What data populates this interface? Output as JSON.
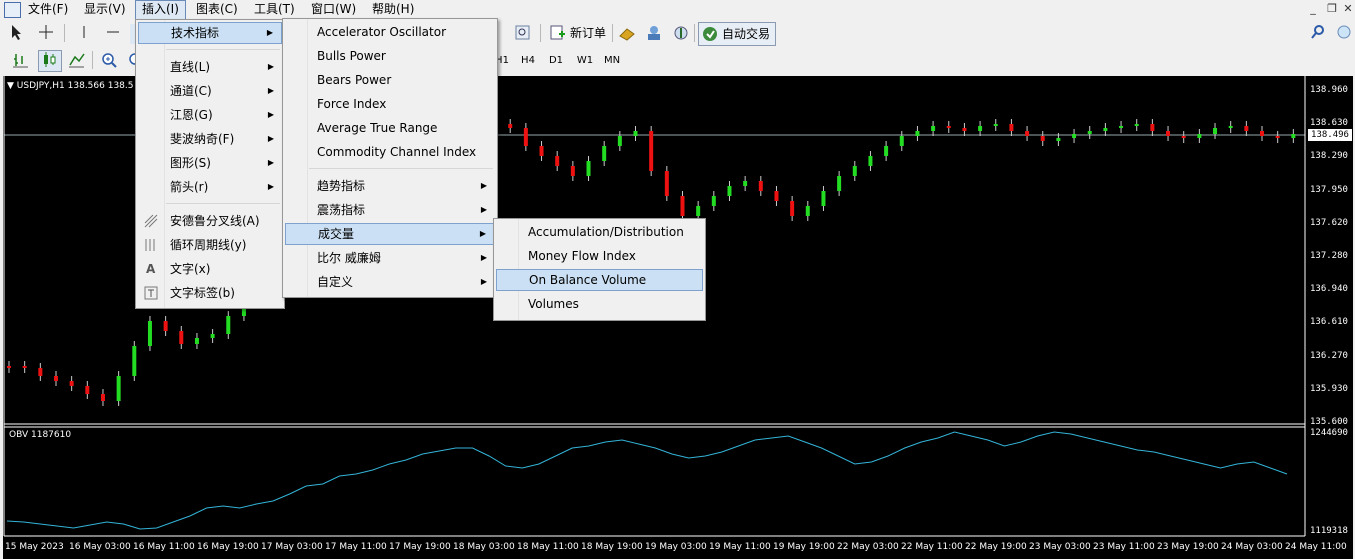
{
  "menubar": {
    "items": [
      "文件(F)",
      "显示(V)",
      "插入(I)",
      "图表(C)",
      "工具(T)",
      "窗口(W)",
      "帮助(H)"
    ]
  },
  "toolbar": {
    "new_order": "新订单",
    "auto_trading": "自动交易",
    "timeframes": [
      "H1",
      "H4",
      "D1",
      "W1",
      "MN"
    ]
  },
  "insert_menu": {
    "items": [
      "技术指标",
      "直线(L)",
      "通道(C)",
      "江恩(G)",
      "斐波纳奇(F)",
      "图形(S)",
      "箭头(r)",
      "安德鲁分叉线(A)",
      "循环周期线(y)",
      "文字(x)",
      "文字标签(b)"
    ]
  },
  "indicators_menu": {
    "items": [
      "Accelerator Oscillator",
      "Bulls Power",
      "Bears Power",
      "Force Index",
      "Average True Range",
      "Commodity Channel Index",
      "趋势指标",
      "震荡指标",
      "成交量",
      "比尔 威廉姆",
      "自定义"
    ]
  },
  "volumes_menu": {
    "items": [
      "Accumulation/Distribution",
      "Money Flow Index",
      "On Balance Volume",
      "Volumes"
    ]
  },
  "chart": {
    "symbol_label": "USDJPY,H1",
    "ohlc_partial": "138.566 138.5",
    "obv_label": "OBV 1187610",
    "current_price": "138.496",
    "price_axis": [
      "138.960",
      "138.630",
      "138.290",
      "137.950",
      "137.620",
      "137.280",
      "136.940",
      "136.610",
      "136.270",
      "135.930",
      "135.600"
    ],
    "obv_axis": [
      "1244690",
      "1119318"
    ],
    "time_axis": [
      "15 May 2023",
      "16 May 03:00",
      "16 May 11:00",
      "16 May 19:00",
      "17 May 03:00",
      "17 May 11:00",
      "17 May 19:00",
      "18 May 03:00",
      "18 May 11:00",
      "18 May 19:00",
      "19 May 03:00",
      "19 May 11:00",
      "19 May 19:00",
      "22 May 03:00",
      "22 May 11:00",
      "22 May 19:00",
      "23 May 03:00",
      "23 May 11:00",
      "23 May 19:00",
      "24 May 03:00",
      "24 May 11:00"
    ],
    "up_color": "#22dd22",
    "down_color": "#ee1111",
    "obv_color": "#34b4d8"
  }
}
